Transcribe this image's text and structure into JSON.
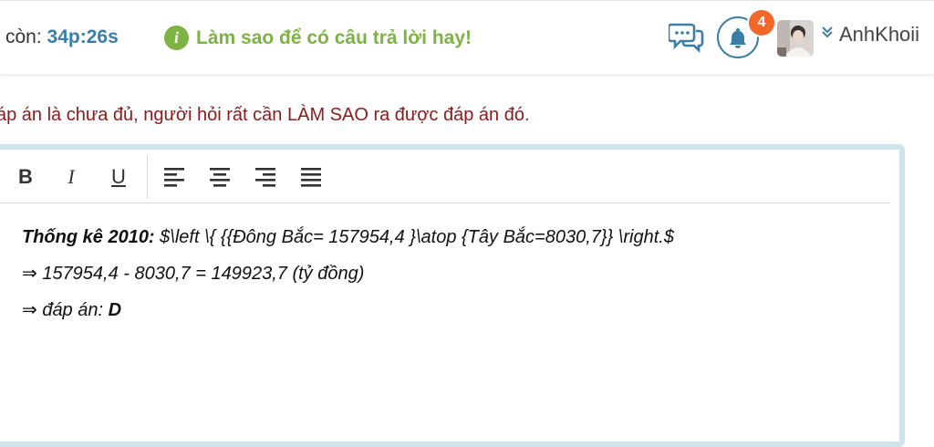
{
  "header": {
    "timer_label": "còn:",
    "timer_value": "34p:26s",
    "tip_text": "Làm sao để có câu trả lời hay!",
    "notification_count": "4",
    "username": "AnhKhoii"
  },
  "instruction_note": "áp án là chưa đủ, người hỏi rất cần LÀM SAO ra được đáp án đó.",
  "toolbar": {
    "bold": "B",
    "italic": "I",
    "underline": "U"
  },
  "answer": {
    "line1_bold": "Thống kê 2010:",
    "line1_rest": " $\\left \\{ {{Đông Bắc= 157954,4 }\\atop {Tây Bắc=8030,7}} \\right.$",
    "line2": "⇒ 157954,4 - 8030,7 = 149923,7 (tỷ đồng)",
    "line3_prefix": "⇒ đáp án: ",
    "line3_answer": "D"
  },
  "colors": {
    "accent_blue": "#3a7ea5",
    "tip_green": "#7cb342",
    "badge_orange": "#f2682a",
    "note_red": "#8b1a1a",
    "editor_border": "#cfe3ea"
  },
  "icons": {
    "tip": "info-icon",
    "chat": "chat-bubbles-icon",
    "bell": "bell-icon",
    "user_menu": "double-chevron-down-icon"
  }
}
